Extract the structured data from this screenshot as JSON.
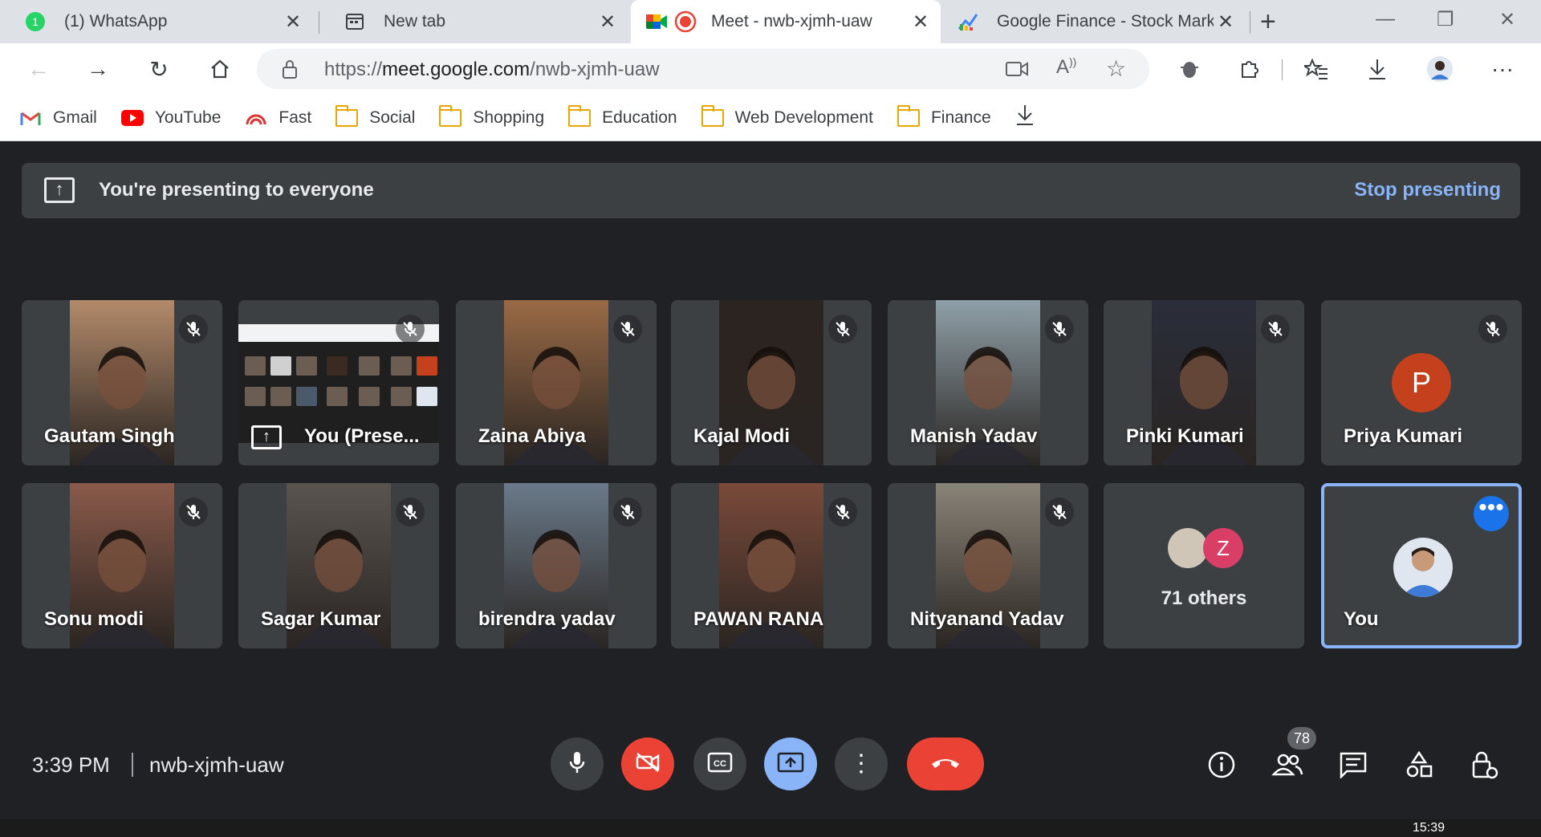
{
  "browser": {
    "tabs": [
      {
        "title": "(1) WhatsApp",
        "icon": "whatsapp-icon",
        "active": false
      },
      {
        "title": "New tab",
        "icon": "newtab-icon",
        "active": false
      },
      {
        "title": "Meet - nwb-xjmh-uaw",
        "icon": "meet-icon",
        "active": true
      },
      {
        "title": "Google Finance - Stock Marke",
        "icon": "finance-icon",
        "active": false
      }
    ],
    "url_prefix": "https://",
    "url_domain": "meet.google.com",
    "url_path": "/nwb-xjmh-uaw",
    "bookmarks": [
      {
        "label": "Gmail",
        "icon": "gmail-icon"
      },
      {
        "label": "YouTube",
        "icon": "youtube-icon"
      },
      {
        "label": "Fast",
        "icon": "speedometer-icon"
      },
      {
        "label": "Social",
        "icon": "folder-icon"
      },
      {
        "label": "Shopping",
        "icon": "folder-icon"
      },
      {
        "label": "Education",
        "icon": "folder-icon"
      },
      {
        "label": "Web Development",
        "icon": "folder-icon"
      },
      {
        "label": "Finance",
        "icon": "folder-icon"
      }
    ]
  },
  "meet": {
    "banner_text": "You're presenting to everyone",
    "stop_label": "Stop presenting",
    "participants": [
      {
        "name": "Gautam Singh",
        "muted": true,
        "color": "#b38a6a"
      },
      {
        "name": "You (Prese...",
        "muted": true,
        "screenshare": true
      },
      {
        "name": "Zaina Abiya",
        "muted": true,
        "color": "#9a6a45"
      },
      {
        "name": "Kajal Modi",
        "muted": true,
        "color": "#2c2420"
      },
      {
        "name": "Manish Yadav",
        "muted": true,
        "color": "#8fa0a8"
      },
      {
        "name": "Pinki Kumari",
        "muted": true,
        "color": "#2a2e3a"
      },
      {
        "name": "Priya Kumari",
        "muted": true,
        "initial": "P"
      },
      {
        "name": "Sonu modi",
        "muted": true,
        "color": "#8a5a4a"
      },
      {
        "name": "Sagar Kumar",
        "muted": true,
        "color": "#5a5450"
      },
      {
        "name": "birendra yadav",
        "muted": true,
        "color": "#6a7a8a"
      },
      {
        "name": "PAWAN RANA",
        "muted": true,
        "color": "#7a4a3a"
      },
      {
        "name": "Nityanand Yadav",
        "muted": true,
        "color": "#8a8378"
      }
    ],
    "others": {
      "label": "71 others",
      "initial": "Z"
    },
    "self": {
      "name": "You"
    },
    "time": "3:39 PM",
    "meeting_code": "nwb-xjmh-uaw",
    "people_count": "78"
  },
  "taskbar": {
    "clock": "15:39"
  }
}
